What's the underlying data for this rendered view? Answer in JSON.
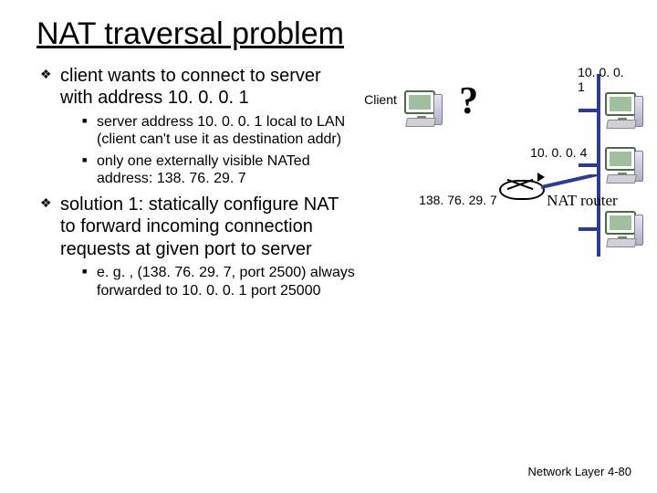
{
  "title": "NAT traversal problem",
  "bullets": {
    "b1": "client wants to connect to server with address 10. 0. 0. 1",
    "b1_sub1": "server address 10. 0. 0. 1 local to LAN (client can't use it as destination addr)",
    "b1_sub2": "only one externally visible NATed address: 138. 76. 29. 7",
    "b2": "solution 1: statically configure NAT to forward incoming connection requests at given port to server",
    "b2_sub1": "e. g. , (138. 76. 29. 7, port 2500) always forwarded to 10. 0. 0. 1 port 25000"
  },
  "diagram": {
    "client": "Client",
    "question": "?",
    "ip_server": "10. 0. 0. 1",
    "ip_pc2": "10. 0. 0. 4",
    "ip_public": "138. 76. 29. 7",
    "router": "NAT router"
  },
  "footer": "Network Layer   4-80"
}
